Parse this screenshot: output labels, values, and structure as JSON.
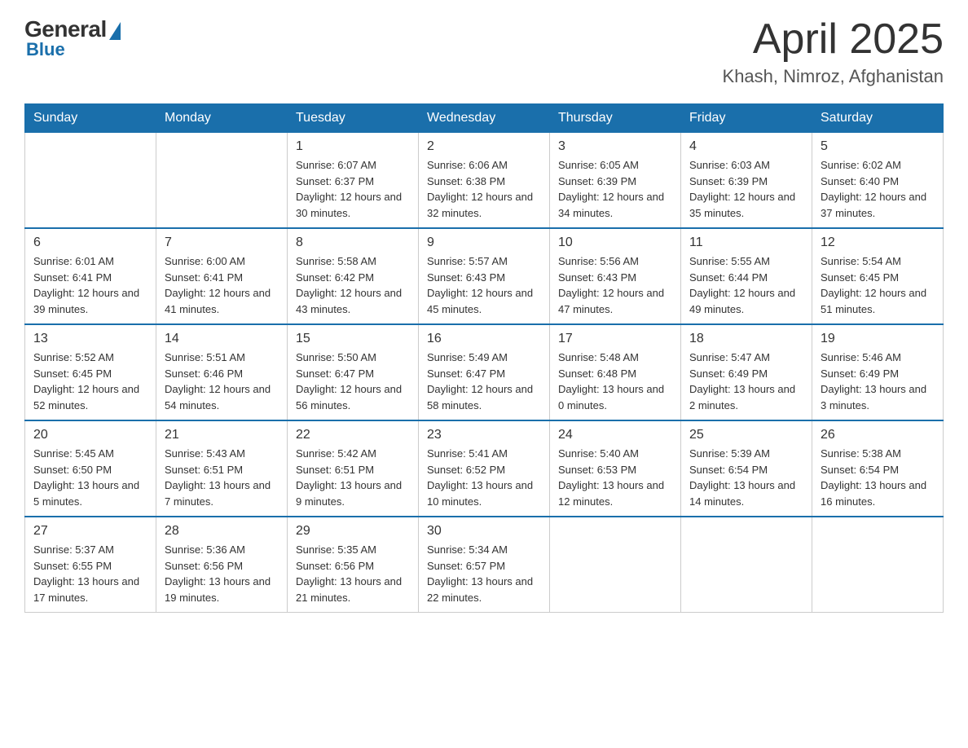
{
  "header": {
    "logo_general": "General",
    "logo_blue": "Blue",
    "title": "April 2025",
    "location": "Khash, Nimroz, Afghanistan"
  },
  "days_of_week": [
    "Sunday",
    "Monday",
    "Tuesday",
    "Wednesday",
    "Thursday",
    "Friday",
    "Saturday"
  ],
  "weeks": [
    [
      {
        "num": "",
        "sunrise": "",
        "sunset": "",
        "daylight": ""
      },
      {
        "num": "",
        "sunrise": "",
        "sunset": "",
        "daylight": ""
      },
      {
        "num": "1",
        "sunrise": "Sunrise: 6:07 AM",
        "sunset": "Sunset: 6:37 PM",
        "daylight": "Daylight: 12 hours and 30 minutes."
      },
      {
        "num": "2",
        "sunrise": "Sunrise: 6:06 AM",
        "sunset": "Sunset: 6:38 PM",
        "daylight": "Daylight: 12 hours and 32 minutes."
      },
      {
        "num": "3",
        "sunrise": "Sunrise: 6:05 AM",
        "sunset": "Sunset: 6:39 PM",
        "daylight": "Daylight: 12 hours and 34 minutes."
      },
      {
        "num": "4",
        "sunrise": "Sunrise: 6:03 AM",
        "sunset": "Sunset: 6:39 PM",
        "daylight": "Daylight: 12 hours and 35 minutes."
      },
      {
        "num": "5",
        "sunrise": "Sunrise: 6:02 AM",
        "sunset": "Sunset: 6:40 PM",
        "daylight": "Daylight: 12 hours and 37 minutes."
      }
    ],
    [
      {
        "num": "6",
        "sunrise": "Sunrise: 6:01 AM",
        "sunset": "Sunset: 6:41 PM",
        "daylight": "Daylight: 12 hours and 39 minutes."
      },
      {
        "num": "7",
        "sunrise": "Sunrise: 6:00 AM",
        "sunset": "Sunset: 6:41 PM",
        "daylight": "Daylight: 12 hours and 41 minutes."
      },
      {
        "num": "8",
        "sunrise": "Sunrise: 5:58 AM",
        "sunset": "Sunset: 6:42 PM",
        "daylight": "Daylight: 12 hours and 43 minutes."
      },
      {
        "num": "9",
        "sunrise": "Sunrise: 5:57 AM",
        "sunset": "Sunset: 6:43 PM",
        "daylight": "Daylight: 12 hours and 45 minutes."
      },
      {
        "num": "10",
        "sunrise": "Sunrise: 5:56 AM",
        "sunset": "Sunset: 6:43 PM",
        "daylight": "Daylight: 12 hours and 47 minutes."
      },
      {
        "num": "11",
        "sunrise": "Sunrise: 5:55 AM",
        "sunset": "Sunset: 6:44 PM",
        "daylight": "Daylight: 12 hours and 49 minutes."
      },
      {
        "num": "12",
        "sunrise": "Sunrise: 5:54 AM",
        "sunset": "Sunset: 6:45 PM",
        "daylight": "Daylight: 12 hours and 51 minutes."
      }
    ],
    [
      {
        "num": "13",
        "sunrise": "Sunrise: 5:52 AM",
        "sunset": "Sunset: 6:45 PM",
        "daylight": "Daylight: 12 hours and 52 minutes."
      },
      {
        "num": "14",
        "sunrise": "Sunrise: 5:51 AM",
        "sunset": "Sunset: 6:46 PM",
        "daylight": "Daylight: 12 hours and 54 minutes."
      },
      {
        "num": "15",
        "sunrise": "Sunrise: 5:50 AM",
        "sunset": "Sunset: 6:47 PM",
        "daylight": "Daylight: 12 hours and 56 minutes."
      },
      {
        "num": "16",
        "sunrise": "Sunrise: 5:49 AM",
        "sunset": "Sunset: 6:47 PM",
        "daylight": "Daylight: 12 hours and 58 minutes."
      },
      {
        "num": "17",
        "sunrise": "Sunrise: 5:48 AM",
        "sunset": "Sunset: 6:48 PM",
        "daylight": "Daylight: 13 hours and 0 minutes."
      },
      {
        "num": "18",
        "sunrise": "Sunrise: 5:47 AM",
        "sunset": "Sunset: 6:49 PM",
        "daylight": "Daylight: 13 hours and 2 minutes."
      },
      {
        "num": "19",
        "sunrise": "Sunrise: 5:46 AM",
        "sunset": "Sunset: 6:49 PM",
        "daylight": "Daylight: 13 hours and 3 minutes."
      }
    ],
    [
      {
        "num": "20",
        "sunrise": "Sunrise: 5:45 AM",
        "sunset": "Sunset: 6:50 PM",
        "daylight": "Daylight: 13 hours and 5 minutes."
      },
      {
        "num": "21",
        "sunrise": "Sunrise: 5:43 AM",
        "sunset": "Sunset: 6:51 PM",
        "daylight": "Daylight: 13 hours and 7 minutes."
      },
      {
        "num": "22",
        "sunrise": "Sunrise: 5:42 AM",
        "sunset": "Sunset: 6:51 PM",
        "daylight": "Daylight: 13 hours and 9 minutes."
      },
      {
        "num": "23",
        "sunrise": "Sunrise: 5:41 AM",
        "sunset": "Sunset: 6:52 PM",
        "daylight": "Daylight: 13 hours and 10 minutes."
      },
      {
        "num": "24",
        "sunrise": "Sunrise: 5:40 AM",
        "sunset": "Sunset: 6:53 PM",
        "daylight": "Daylight: 13 hours and 12 minutes."
      },
      {
        "num": "25",
        "sunrise": "Sunrise: 5:39 AM",
        "sunset": "Sunset: 6:54 PM",
        "daylight": "Daylight: 13 hours and 14 minutes."
      },
      {
        "num": "26",
        "sunrise": "Sunrise: 5:38 AM",
        "sunset": "Sunset: 6:54 PM",
        "daylight": "Daylight: 13 hours and 16 minutes."
      }
    ],
    [
      {
        "num": "27",
        "sunrise": "Sunrise: 5:37 AM",
        "sunset": "Sunset: 6:55 PM",
        "daylight": "Daylight: 13 hours and 17 minutes."
      },
      {
        "num": "28",
        "sunrise": "Sunrise: 5:36 AM",
        "sunset": "Sunset: 6:56 PM",
        "daylight": "Daylight: 13 hours and 19 minutes."
      },
      {
        "num": "29",
        "sunrise": "Sunrise: 5:35 AM",
        "sunset": "Sunset: 6:56 PM",
        "daylight": "Daylight: 13 hours and 21 minutes."
      },
      {
        "num": "30",
        "sunrise": "Sunrise: 5:34 AM",
        "sunset": "Sunset: 6:57 PM",
        "daylight": "Daylight: 13 hours and 22 minutes."
      },
      {
        "num": "",
        "sunrise": "",
        "sunset": "",
        "daylight": ""
      },
      {
        "num": "",
        "sunrise": "",
        "sunset": "",
        "daylight": ""
      },
      {
        "num": "",
        "sunrise": "",
        "sunset": "",
        "daylight": ""
      }
    ]
  ]
}
